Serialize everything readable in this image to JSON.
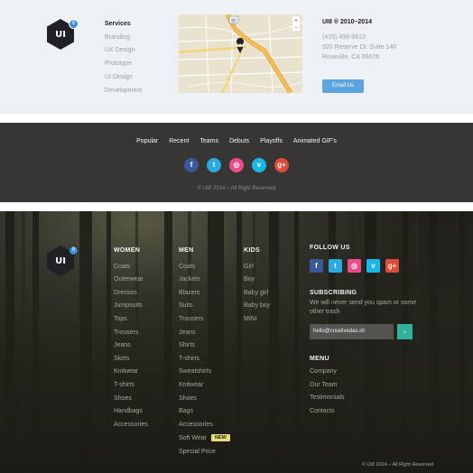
{
  "brand": {
    "logo_text": "UI",
    "badge_text": "8"
  },
  "top": {
    "services_title": "Services",
    "services": [
      "Branding",
      "UX Design",
      "Prototype",
      "UI Design",
      "Development"
    ],
    "company": "UI8 ® 2010–2014",
    "phone": "(415) 496-9612",
    "address1": "920 Reserve Dr. Suite 140",
    "address2": "Roseville, CA 95678",
    "email_button": "Email Us",
    "map_shield": "80"
  },
  "mid": {
    "nav": [
      "Popular",
      "Recent",
      "Teams",
      "Debuts",
      "Playoffs",
      "Animated GIF's"
    ],
    "copyright": "© UI8 2014 – All Right Reserved"
  },
  "social": [
    {
      "name": "facebook-icon",
      "glyph": "f",
      "color": "#3b5998"
    },
    {
      "name": "twitter-icon",
      "glyph": "t",
      "color": "#2aa9e0"
    },
    {
      "name": "dribbble-icon",
      "glyph": "◎",
      "color": "#ea4c89"
    },
    {
      "name": "vimeo-icon",
      "glyph": "v",
      "color": "#1ab7ea"
    },
    {
      "name": "google-plus-icon",
      "glyph": "g+",
      "color": "#dd4b39"
    }
  ],
  "bottom": {
    "women_title": "WOMEN",
    "women": [
      "Coats",
      "Outerwear",
      "Dresses",
      "Jumpsuits",
      "Tops",
      "Trousers",
      "Jeans",
      "Skirts",
      "Knitwear",
      "T-shirts",
      "Shoes",
      "Handbags",
      "Accessories"
    ],
    "men_title": "MEN",
    "men": [
      "Coats",
      "Jackets",
      "Blazers",
      "Suits",
      "Trousers",
      "Jeans",
      "Shirts",
      "T-shirts",
      "Sweatshirts",
      "Knitwear",
      "Shoes",
      "Bags",
      "Accessories",
      "Soft Wear",
      "Special Price"
    ],
    "new_badge": "NEW",
    "kids_title": "KIDS",
    "kids": [
      "Girl",
      "Boy",
      "Baby girl",
      "Baby boy",
      "MINI"
    ],
    "follow_title": "FOLLOW US",
    "subscribe_title": "SUBSCRIBING",
    "subscribe_text": "We will never send you spam or some other trash",
    "subscribe_value": "hello@creativedas.sh",
    "subscribe_button": "›",
    "menu_title": "MENU",
    "menu": [
      "Company",
      "Our Team",
      "Testimonials",
      "Contacts"
    ],
    "copyright": "© UI8 2014 – All Right Reserved"
  }
}
